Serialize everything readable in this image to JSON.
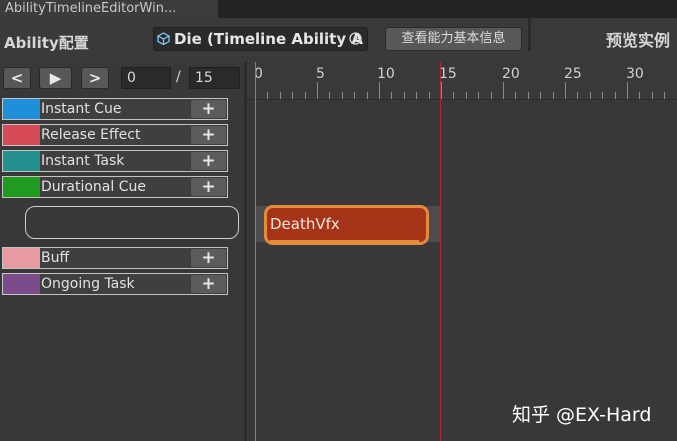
{
  "window": {
    "tab_title": "AbilityTimelineEditorWin..."
  },
  "header": {
    "title": "Ability配置",
    "asset_name": "Die (Timeline Ability A",
    "info_button": "查看能力基本信息",
    "preview_title": "预览实例"
  },
  "controls": {
    "prev_label": "<",
    "play_label": "▶",
    "next_label": ">",
    "current_frame": "0",
    "slash": "/",
    "total_frames": "15"
  },
  "ruler": {
    "ticks": [
      "0",
      "5",
      "10",
      "15",
      "20",
      "25",
      "30"
    ]
  },
  "tracks": [
    {
      "label": "Instant Cue",
      "color": "#1e8fd8",
      "add": "+"
    },
    {
      "label": "Release Effect",
      "color": "#d74a58",
      "add": "+"
    },
    {
      "label": "Instant Task",
      "color": "#23918d",
      "add": "+"
    },
    {
      "label": "Durational Cue",
      "color": "#1f9b1f",
      "add": "+"
    },
    {
      "label": "Buff",
      "color": "#e79ba0",
      "add": "+"
    },
    {
      "label": "Ongoing Task",
      "color": "#7c4b8c",
      "add": "+"
    }
  ],
  "clip": {
    "label": "DeathVfx"
  },
  "watermark": {
    "text": "知乎 @EX-Hard"
  }
}
